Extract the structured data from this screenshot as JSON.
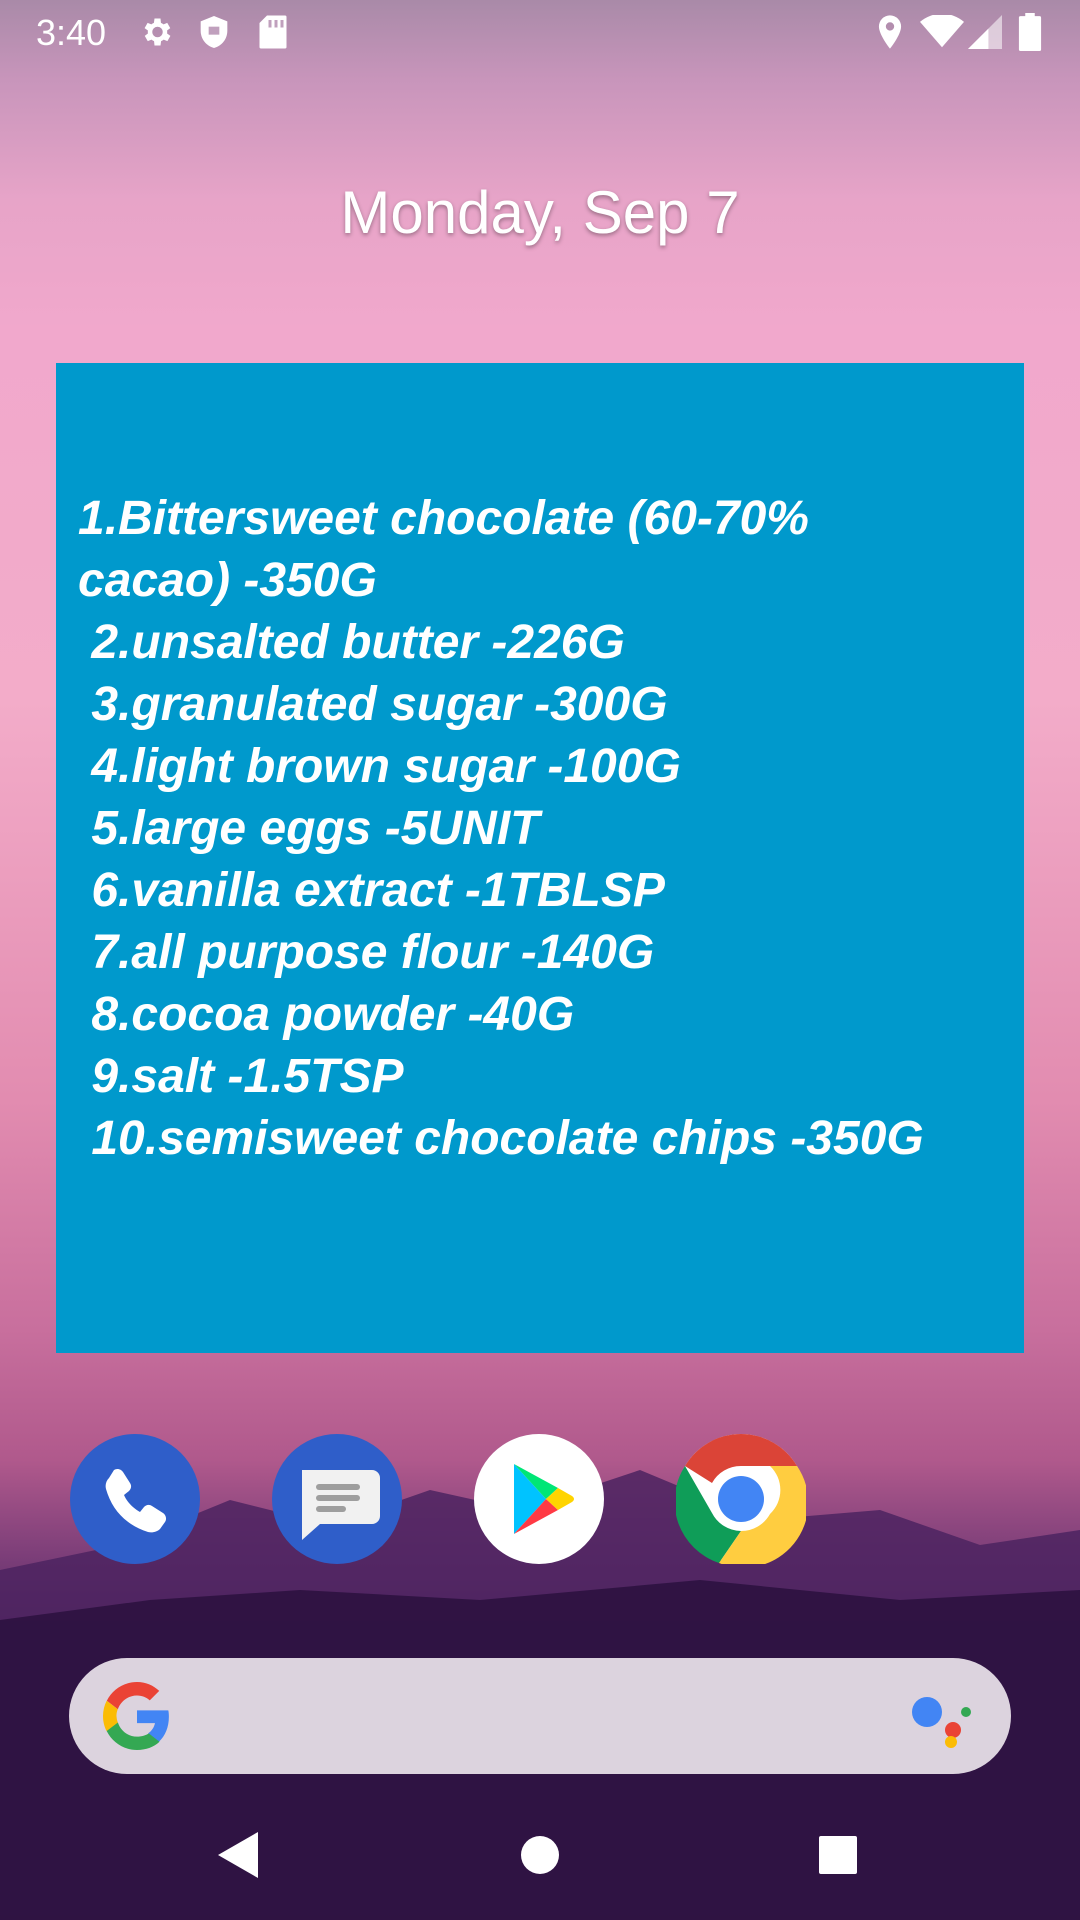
{
  "status_bar": {
    "time": "3:40",
    "left_icons": [
      "settings-icon",
      "shield-icon",
      "sd-card-icon"
    ],
    "right_icons": [
      "location-icon",
      "wifi-icon",
      "signal-icon",
      "battery-icon"
    ]
  },
  "date": "Monday, Sep 7",
  "note_widget": {
    "background": "#0099cc",
    "text": "1.Bittersweet chocolate (60-70%\ncacao) -350G\n 2.unsalted butter -226G\n 3.granulated sugar -300G\n 4.light brown sugar -100G\n 5.large eggs -5UNIT\n 6.vanilla extract -1TBLSP\n 7.all purpose flour -140G\n 8.cocoa powder -40G\n 9.salt -1.5TSP\n 10.semisweet chocolate chips -350G"
  },
  "dock": [
    "phone-app",
    "messages-app",
    "play-store-app",
    "chrome-app"
  ],
  "search_bar": {
    "icons": [
      "google-g-icon",
      "assistant-icon"
    ]
  },
  "nav_bar": [
    "back-button",
    "home-button",
    "recents-button"
  ]
}
